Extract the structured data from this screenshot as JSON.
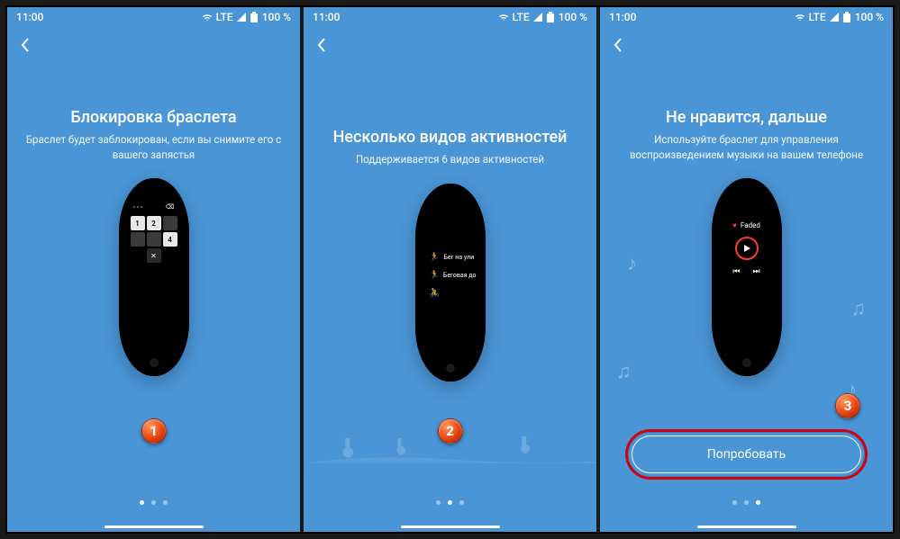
{
  "status": {
    "time": "11:00",
    "net": "LTE",
    "battery": "100 %"
  },
  "panels": [
    {
      "title": "Блокировка браслета",
      "subtitle": "Браслет будет заблокирован, если вы снимите его с вашего запястья",
      "step": "1",
      "dots_active": 0,
      "pad_keys": [
        "1",
        "2",
        "",
        "",
        "",
        "4",
        "",
        "✕",
        ""
      ]
    },
    {
      "title": "Несколько видов активностей",
      "subtitle": "Поддерживается 6 видов активностей",
      "step": "2",
      "dots_active": 1,
      "activities": [
        "Бег на ули",
        "Беговая до"
      ]
    },
    {
      "title": "Не нравится, дальше",
      "subtitle": "Используйте браслет для управления воспроизведением музыки на вашем телефоне",
      "step": "3",
      "dots_active": 2,
      "track": "Faded",
      "cta": "Попробовать"
    }
  ]
}
